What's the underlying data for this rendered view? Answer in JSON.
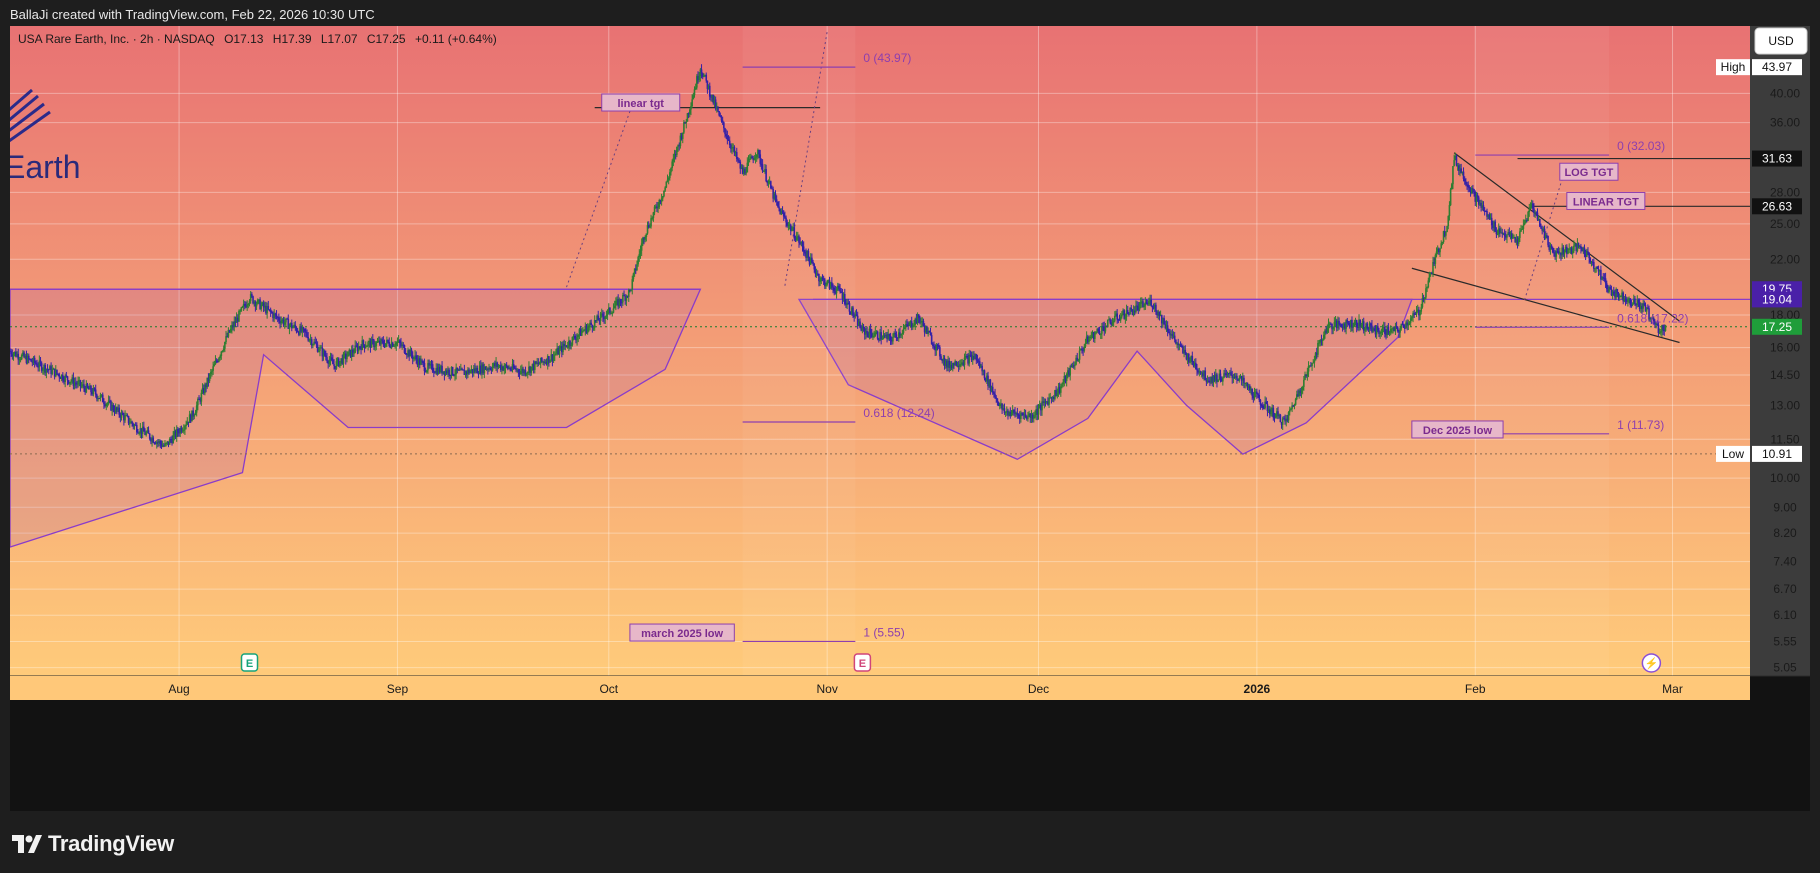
{
  "header": {
    "credit": "BallaJi created with TradingView.com, Feb 22, 2026 10:30 UTC"
  },
  "footer": {
    "brand": "TradingView"
  },
  "symbol": {
    "name": "USA Rare Earth, Inc. · 2h · NASDAQ",
    "open": "O17.13",
    "high": "H17.39",
    "low": "L17.07",
    "close": "C17.25",
    "change": "+0.11 (+0.64%)"
  },
  "logo_text": "Earth",
  "currency_button": "USD",
  "colors": {
    "bg_top": "#e87273",
    "bg_bottom": "#ffcb7a",
    "up_candle": "#2e7d32",
    "down_candle": "#3320a8",
    "fib": "#8e3fae",
    "pattern": "#8a3cc9"
  },
  "chart_data": {
    "type": "candlestick",
    "title": "USA Rare Earth, Inc. · 2h · NASDAQ",
    "y_scale": "log",
    "ylim": [
      4.9,
      51
    ],
    "y_ticks": [
      "40.00",
      "36.00",
      "28.00",
      "25.00",
      "22.00",
      "18.00",
      "16.00",
      "14.50",
      "13.00",
      "11.50",
      "10.00",
      "9.00",
      "8.20",
      "7.40",
      "6.70",
      "6.10",
      "5.55",
      "5.05"
    ],
    "x_range": [
      "2025-07-08",
      "2026-03-12"
    ],
    "x_ticks": [
      {
        "date": "2025-08-01",
        "label": "Aug",
        "bold": false
      },
      {
        "date": "2025-09-01",
        "label": "Sep",
        "bold": false
      },
      {
        "date": "2025-10-01",
        "label": "Oct",
        "bold": false
      },
      {
        "date": "2025-11-01",
        "label": "Nov",
        "bold": false
      },
      {
        "date": "2025-12-01",
        "label": "Dec",
        "bold": false
      },
      {
        "date": "2026-01-01",
        "label": "2026",
        "bold": true
      },
      {
        "date": "2026-02-01",
        "label": "Feb",
        "bold": false
      },
      {
        "date": "2026-03-01",
        "label": "Mar",
        "bold": false
      }
    ],
    "price_path": [
      [
        "2025-07-08",
        15.8
      ],
      [
        "2025-07-14",
        14.7
      ],
      [
        "2025-07-20",
        13.6
      ],
      [
        "2025-07-26",
        12.0
      ],
      [
        "2025-07-30",
        11.2
      ],
      [
        "2025-08-03",
        12.6
      ],
      [
        "2025-08-08",
        16.8
      ],
      [
        "2025-08-11",
        19.2
      ],
      [
        "2025-08-15",
        17.8
      ],
      [
        "2025-08-19",
        16.8
      ],
      [
        "2025-08-23",
        15.0
      ],
      [
        "2025-08-27",
        16.2
      ],
      [
        "2025-09-01",
        16.3
      ],
      [
        "2025-09-05",
        14.9
      ],
      [
        "2025-09-10",
        14.6
      ],
      [
        "2025-09-15",
        15.0
      ],
      [
        "2025-09-19",
        14.7
      ],
      [
        "2025-09-23",
        15.5
      ],
      [
        "2025-09-27",
        16.9
      ],
      [
        "2025-10-01",
        18.2
      ],
      [
        "2025-10-04",
        19.6
      ],
      [
        "2025-10-06",
        24.0
      ],
      [
        "2025-10-09",
        28.5
      ],
      [
        "2025-10-12",
        36.5
      ],
      [
        "2025-10-14",
        43.97
      ],
      [
        "2025-10-17",
        36.0
      ],
      [
        "2025-10-20",
        30.0
      ],
      [
        "2025-10-22",
        32.5
      ],
      [
        "2025-10-25",
        26.5
      ],
      [
        "2025-10-28",
        23.5
      ],
      [
        "2025-10-31",
        20.5
      ],
      [
        "2025-11-03",
        19.5
      ],
      [
        "2025-11-06",
        17.0
      ],
      [
        "2025-11-10",
        16.5
      ],
      [
        "2025-11-14",
        17.8
      ],
      [
        "2025-11-18",
        15.0
      ],
      [
        "2025-11-22",
        15.5
      ],
      [
        "2025-11-26",
        12.7
      ],
      [
        "2025-11-30",
        12.5
      ],
      [
        "2025-12-04",
        13.8
      ],
      [
        "2025-12-08",
        16.5
      ],
      [
        "2025-12-12",
        17.8
      ],
      [
        "2025-12-17",
        18.9
      ],
      [
        "2025-12-21",
        16.0
      ],
      [
        "2025-12-25",
        14.3
      ],
      [
        "2025-12-29",
        14.5
      ],
      [
        "2026-01-02",
        13.0
      ],
      [
        "2026-01-05",
        12.2
      ],
      [
        "2026-01-08",
        14.5
      ],
      [
        "2026-01-11",
        17.3
      ],
      [
        "2026-01-15",
        17.5
      ],
      [
        "2026-01-18",
        17.0
      ],
      [
        "2026-01-21",
        17.0
      ],
      [
        "2026-01-24",
        18.2
      ],
      [
        "2026-01-26",
        21.5
      ],
      [
        "2026-01-28",
        25.0
      ],
      [
        "2026-01-29",
        31.63
      ],
      [
        "2026-02-01",
        27.5
      ],
      [
        "2026-02-04",
        24.5
      ],
      [
        "2026-02-07",
        23.5
      ],
      [
        "2026-02-09",
        26.8
      ],
      [
        "2026-02-12",
        22.5
      ],
      [
        "2026-02-16",
        23.0
      ],
      [
        "2026-02-18",
        21.5
      ],
      [
        "2026-02-20",
        19.7
      ],
      [
        "2026-02-23",
        19.0
      ],
      [
        "2026-02-25",
        18.5
      ],
      [
        "2026-02-27",
        17.1
      ],
      [
        "2026-02-28",
        17.25
      ]
    ],
    "last_price": "17.25",
    "stats": {
      "high": "43.97",
      "low": "10.91",
      "high_label": "High",
      "low_label": "Low"
    },
    "price_markers": [
      {
        "value": "31.63",
        "kind": "line"
      },
      {
        "value": "26.63",
        "kind": "line"
      },
      {
        "value": "19.75",
        "kind": "level"
      },
      {
        "value": "19.04",
        "kind": "level"
      },
      {
        "value": "17.25",
        "kind": "last"
      }
    ],
    "fib_left": {
      "x_start": "2025-10-20",
      "x_end": "2025-11-05",
      "levels": [
        {
          "price": 43.97,
          "label": "0 (43.97)"
        },
        {
          "price": 12.24,
          "label": "0.618 (12.24)"
        },
        {
          "price": 5.55,
          "label": "1 (5.55)"
        }
      ]
    },
    "fib_right": {
      "x_start": "2026-02-01",
      "x_end": "2026-02-20",
      "levels": [
        {
          "price": 32.03,
          "label": "0 (32.03)"
        },
        {
          "price": 17.22,
          "label": "0.618 (17.22)"
        },
        {
          "price": 11.73,
          "label": "1 (11.73)"
        }
      ]
    },
    "annotations": [
      {
        "text": "linear tgt",
        "date": "2025-09-30",
        "price": 38.5
      },
      {
        "text": "LOG TGT",
        "date": "2026-02-13",
        "price": 30.0
      },
      {
        "text": "LINEAR TGT",
        "date": "2026-02-14",
        "price": 27.0
      },
      {
        "text": "Dec 2025 low",
        "date": "2026-01-23",
        "price": 11.85
      },
      {
        "text": "march 2025 low",
        "date": "2025-10-04",
        "price": 5.7
      }
    ],
    "horizontal_levels": [
      {
        "price": 19.75,
        "from": "2025-07-08",
        "to": "2025-10-14"
      },
      {
        "price": 19.04,
        "from": "2025-10-30",
        "to": "2026-03-12"
      },
      {
        "price": 31.63,
        "from": "2026-02-07",
        "to": "2026-03-12"
      },
      {
        "price": 26.63,
        "from": "2026-02-09",
        "to": "2026-03-12"
      },
      {
        "price": 38.0,
        "from": "2025-09-29",
        "to": "2025-10-31"
      }
    ],
    "event_markers": [
      {
        "date": "2025-08-11",
        "symbol": "E"
      },
      {
        "date": "2025-11-06",
        "symbol": "E"
      },
      {
        "date": "2026-02-26",
        "symbol": "⚡"
      }
    ]
  }
}
